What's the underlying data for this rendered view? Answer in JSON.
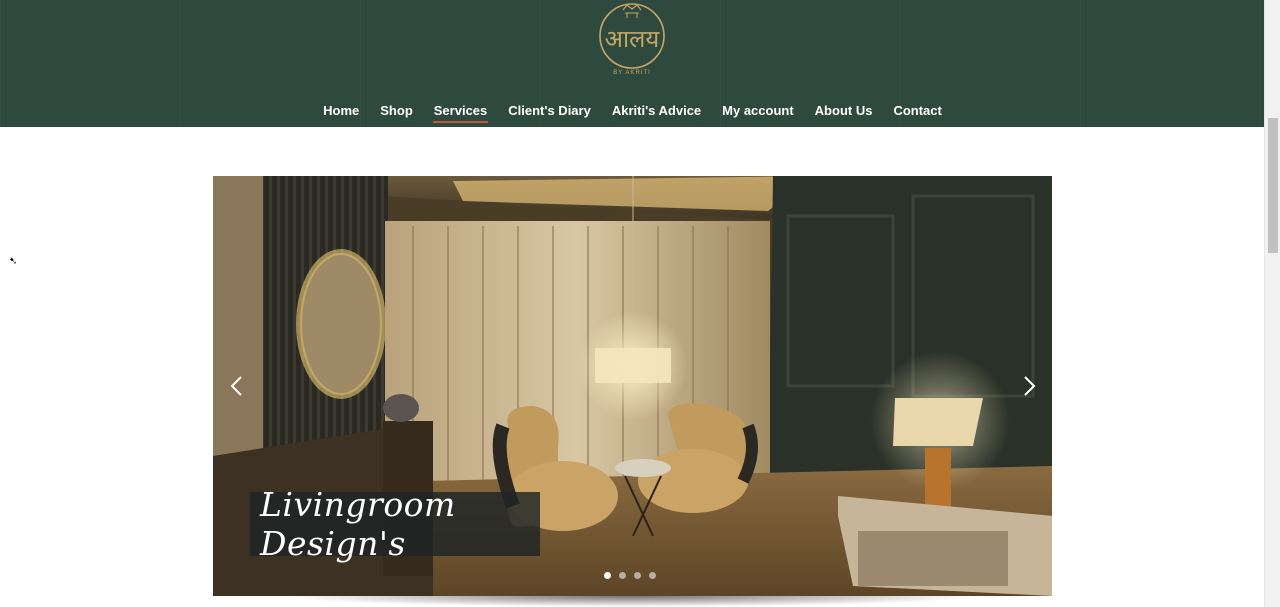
{
  "header": {
    "logo_text": "आलय",
    "logo_sub": "BY AKRITI",
    "brand_color": "#2e4a3f",
    "accent_color": "#c0563c",
    "gold_color": "#c6a665"
  },
  "nav": {
    "items": [
      {
        "label": "Home",
        "active": false
      },
      {
        "label": "Shop",
        "active": false
      },
      {
        "label": "Services",
        "active": true
      },
      {
        "label": "Client's Diary",
        "active": false
      },
      {
        "label": "Akriti's Advice",
        "active": false
      },
      {
        "label": "My account",
        "active": false
      },
      {
        "label": "About Us",
        "active": false
      },
      {
        "label": "Contact",
        "active": false
      }
    ]
  },
  "slider": {
    "caption": "Livingroom Design's",
    "prev_icon": "chevron-left-icon",
    "next_icon": "chevron-right-icon",
    "slide_count": 4,
    "active_slide": 1
  }
}
